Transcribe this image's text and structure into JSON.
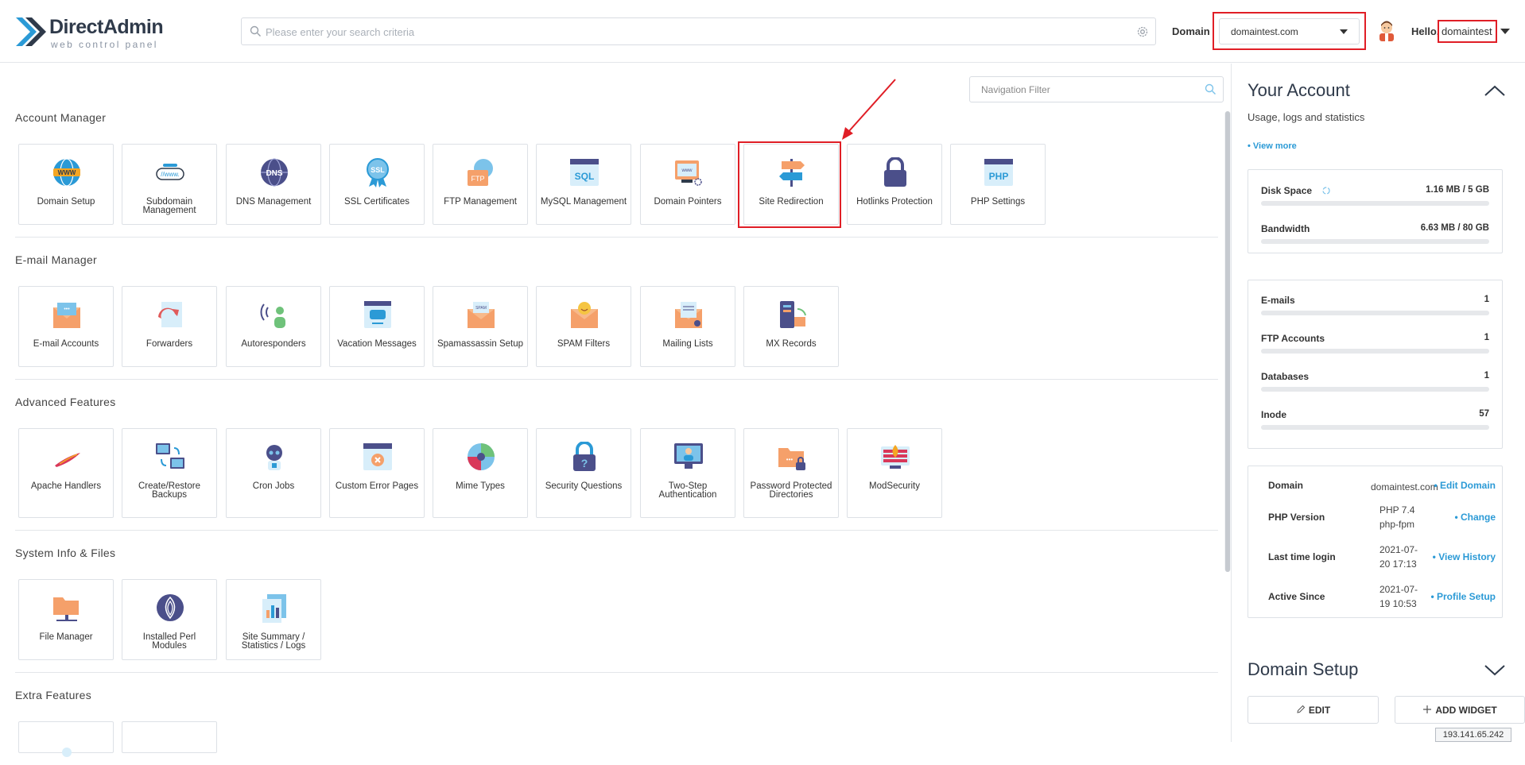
{
  "header": {
    "logo_title": "DirectAdmin",
    "logo_subtitle": "web control panel",
    "search_placeholder": "Please enter your search criteria",
    "domain_label": "Domain",
    "domain_value": "domaintest.com",
    "hello": "Hello,",
    "username": "domaintest"
  },
  "main": {
    "nav_filter_placeholder": "Navigation Filter",
    "sections": [
      {
        "title": "Account Manager",
        "items": [
          {
            "label": "Domain Setup",
            "icon": "globe-www-icon"
          },
          {
            "label": "Subdomain Management",
            "icon": "subdomain-icon"
          },
          {
            "label": "DNS Management",
            "icon": "dns-icon"
          },
          {
            "label": "SSL Certificates",
            "icon": "ssl-badge-icon"
          },
          {
            "label": "FTP Management",
            "icon": "ftp-globe-icon"
          },
          {
            "label": "MySQL Management",
            "icon": "mysql-window-icon"
          },
          {
            "label": "Domain Pointers",
            "icon": "domain-pointer-icon"
          },
          {
            "label": "Site Redirection",
            "icon": "signpost-icon"
          },
          {
            "label": "Hotlinks Protection",
            "icon": "padlock-icon"
          },
          {
            "label": "PHP Settings",
            "icon": "php-window-icon"
          }
        ]
      },
      {
        "title": "E-mail Manager",
        "items": [
          {
            "label": "E-mail Accounts",
            "icon": "envelope-icon"
          },
          {
            "label": "Forwarders",
            "icon": "forward-document-icon"
          },
          {
            "label": "Autoresponders",
            "icon": "autoresponder-icon"
          },
          {
            "label": "Vacation Messages",
            "icon": "vacation-message-icon"
          },
          {
            "label": "Spamassassin Setup",
            "icon": "spam-envelope-icon"
          },
          {
            "label": "SPAM Filters",
            "icon": "smiley-envelope-icon"
          },
          {
            "label": "Mailing Lists",
            "icon": "mailing-list-icon"
          },
          {
            "label": "MX Records",
            "icon": "mx-server-icon"
          }
        ]
      },
      {
        "title": "Advanced Features",
        "items": [
          {
            "label": "Apache Handlers",
            "icon": "apache-feather-icon"
          },
          {
            "label": "Create/Restore Backups",
            "icon": "backup-monitors-icon"
          },
          {
            "label": "Cron Jobs",
            "icon": "robot-icon"
          },
          {
            "label": "Custom Error Pages",
            "icon": "error-page-icon"
          },
          {
            "label": "Mime Types",
            "icon": "mime-types-icon"
          },
          {
            "label": "Security Questions",
            "icon": "question-lock-icon"
          },
          {
            "label": "Two-Step Authentication",
            "icon": "two-step-monitor-icon"
          },
          {
            "label": "Password Protected Directories",
            "icon": "protected-folder-icon"
          },
          {
            "label": "ModSecurity",
            "icon": "firewall-icon"
          }
        ]
      },
      {
        "title": "System Info & Files",
        "items": [
          {
            "label": "File Manager",
            "icon": "folder-icon"
          },
          {
            "label": "Installed Perl Modules",
            "icon": "perl-onion-icon"
          },
          {
            "label": "Site Summary / Statistics / Logs",
            "icon": "statistics-icon"
          }
        ]
      },
      {
        "title": "Extra Features",
        "items": []
      }
    ]
  },
  "account": {
    "title": "Your Account",
    "subtitle": "Usage, logs and statistics",
    "view_more": "• View more",
    "usage": [
      {
        "label": "Disk Space",
        "value": "1.16 MB / 5 GB",
        "fraction": 0.0002
      },
      {
        "label": "Bandwidth",
        "value": "6.63 MB / 80 GB",
        "fraction": 0.0001
      }
    ],
    "counts": [
      {
        "label": "E-mails",
        "value": "1"
      },
      {
        "label": "FTP Accounts",
        "value": "1"
      },
      {
        "label": "Databases",
        "value": "1"
      },
      {
        "label": "Inode",
        "value": "57"
      }
    ],
    "info": [
      {
        "label": "Domain",
        "value": "domaintest.com",
        "action": "• Edit Domain"
      },
      {
        "label": "PHP Version",
        "value": "PHP 7.4 php-fpm",
        "action": "• Change"
      },
      {
        "label": "Last time login",
        "value": "2021-07-20 17:13",
        "action": "• View History"
      },
      {
        "label": "Active Since",
        "value": "2021-07-19 10:53",
        "action": "• Profile Setup"
      }
    ]
  },
  "domain_setup": {
    "title": "Domain Setup",
    "edit_label": "EDIT",
    "add_widget_label": "ADD WIDGET"
  },
  "status": {
    "ip": "193.141.65.242"
  },
  "colors": {
    "accent": "#2b9ad6",
    "highlight": "#e01e26",
    "brand_dark": "#2f3a4a"
  }
}
